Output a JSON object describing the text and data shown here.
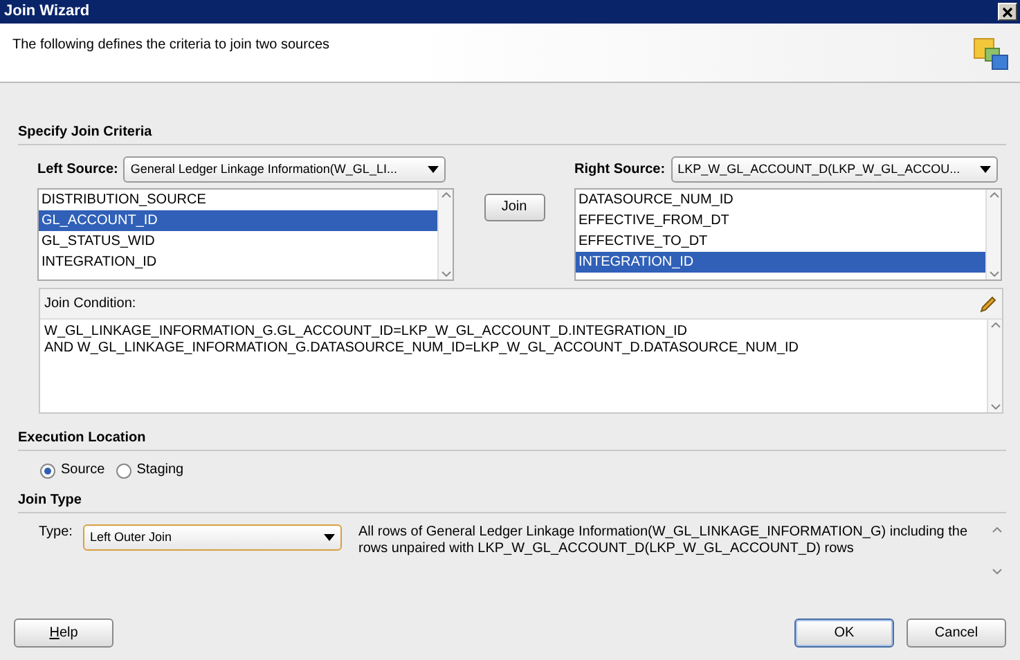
{
  "window": {
    "title": "Join Wizard"
  },
  "header": {
    "description": "The following defines the criteria to join two sources"
  },
  "join_criteria": {
    "heading": "Specify Join Criteria",
    "left_source": {
      "label": "Left Source:",
      "value": "General Ledger Linkage Information(W_GL_LI...",
      "columns": [
        {
          "label": "DISTRIBUTION_SOURCE",
          "selected": false
        },
        {
          "label": "GL_ACCOUNT_ID",
          "selected": true
        },
        {
          "label": "GL_STATUS_WID",
          "selected": false
        },
        {
          "label": "INTEGRATION_ID",
          "selected": false
        }
      ]
    },
    "join_button": "Join",
    "right_source": {
      "label": "Right Source:",
      "value": "LKP_W_GL_ACCOUNT_D(LKP_W_GL_ACCOU...",
      "columns": [
        {
          "label": "DATASOURCE_NUM_ID",
          "selected": false
        },
        {
          "label": "EFFECTIVE_FROM_DT",
          "selected": false
        },
        {
          "label": "EFFECTIVE_TO_DT",
          "selected": false
        },
        {
          "label": "INTEGRATION_ID",
          "selected": true
        }
      ]
    },
    "join_condition": {
      "label": "Join Condition:",
      "lines": [
        "W_GL_LINKAGE_INFORMATION_G.GL_ACCOUNT_ID=LKP_W_GL_ACCOUNT_D.INTEGRATION_ID",
        "AND W_GL_LINKAGE_INFORMATION_G.DATASOURCE_NUM_ID=LKP_W_GL_ACCOUNT_D.DATASOURCE_NUM_ID"
      ]
    }
  },
  "execution_location": {
    "heading": "Execution Location",
    "options": [
      {
        "label": "Source",
        "selected": true
      },
      {
        "label": "Staging",
        "selected": false
      }
    ]
  },
  "join_type": {
    "heading": "Join Type",
    "label": "Type:",
    "value": "Left Outer Join",
    "description": "All rows of General Ledger Linkage Information(W_GL_LINKAGE_INFORMATION_G) including the rows unpaired with LKP_W_GL_ACCOUNT_D(LKP_W_GL_ACCOUNT_D) rows"
  },
  "buttons": [
    {
      "label": "Help",
      "kind": "help"
    },
    {
      "label": "OK",
      "kind": "default"
    },
    {
      "label": "Cancel",
      "kind": "normal"
    }
  ]
}
